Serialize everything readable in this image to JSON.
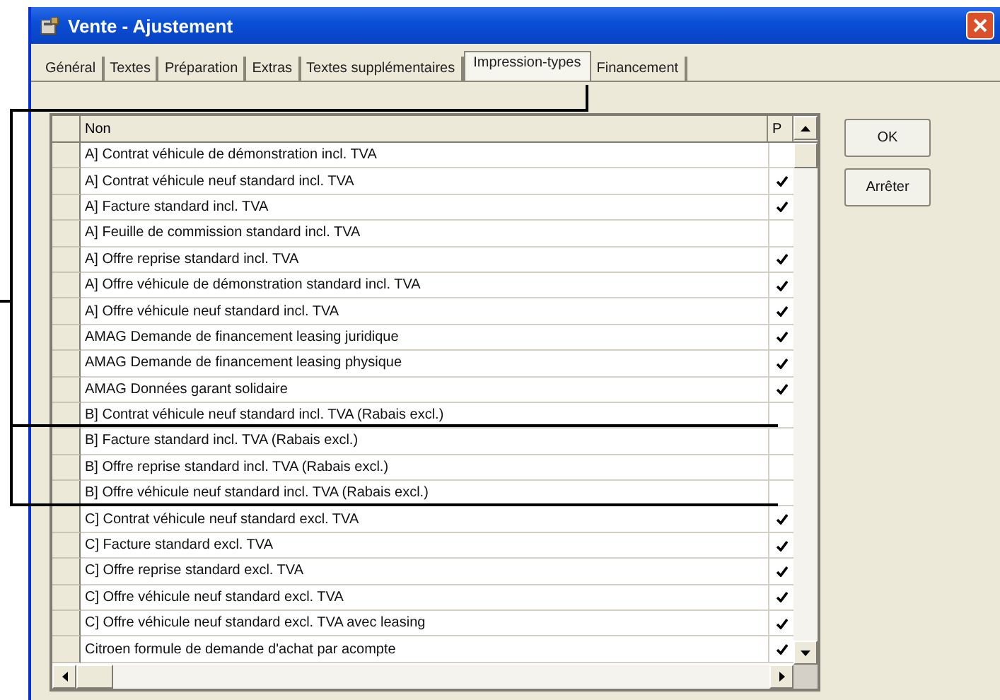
{
  "window": {
    "title": "Vente - Ajustement"
  },
  "tabs": [
    {
      "label": "Général",
      "selected": false
    },
    {
      "label": "Textes",
      "selected": false
    },
    {
      "label": "Préparation",
      "selected": false
    },
    {
      "label": "Extras",
      "selected": false
    },
    {
      "label": "Textes supplémentaires",
      "selected": false
    },
    {
      "label": "Impression-types",
      "selected": true
    },
    {
      "label": "Financement",
      "selected": false
    }
  ],
  "table": {
    "columns": [
      "Non",
      "P"
    ],
    "rows": [
      {
        "name": "A] Contrat véhicule de démonstration incl. TVA",
        "printed": false
      },
      {
        "name": "A] Contrat véhicule neuf standard incl. TVA",
        "printed": true
      },
      {
        "name": "A] Facture standard incl. TVA",
        "printed": true
      },
      {
        "name": "A] Feuille de commission standard incl. TVA",
        "printed": false
      },
      {
        "name": "A] Offre reprise standard incl. TVA",
        "printed": true
      },
      {
        "name": "A] Offre véhicule de démonstration standard incl. TVA",
        "printed": true
      },
      {
        "name": "A] Offre véhicule neuf standard incl. TVA",
        "printed": true
      },
      {
        "name": "AMAG Demande de financement leasing juridique",
        "printed": true
      },
      {
        "name": "AMAG Demande de financement leasing physique",
        "printed": true
      },
      {
        "name": "AMAG Données garant solidaire",
        "printed": true
      },
      {
        "name": "B] Contrat véhicule neuf standard incl. TVA (Rabais excl.)",
        "printed": false
      },
      {
        "name": "B] Facture standard incl. TVA (Rabais excl.)",
        "printed": false
      },
      {
        "name": "B] Offre reprise standard incl. TVA (Rabais excl.)",
        "printed": false
      },
      {
        "name": "B] Offre véhicule neuf standard incl. TVA (Rabais excl.)",
        "printed": false
      },
      {
        "name": "C] Contrat véhicule neuf standard excl. TVA",
        "printed": true
      },
      {
        "name": "C] Facture standard excl. TVA",
        "printed": true
      },
      {
        "name": "C] Offre reprise standard excl. TVA",
        "printed": true
      },
      {
        "name": "C] Offre véhicule neuf standard excl. TVA",
        "printed": true
      },
      {
        "name": "C] Offre véhicule neuf standard excl. TVA avec leasing",
        "printed": true
      },
      {
        "name": "Citroen formule de demande d'achat par acompte",
        "printed": true
      }
    ]
  },
  "buttons": [
    "OK",
    "Arrêter"
  ]
}
